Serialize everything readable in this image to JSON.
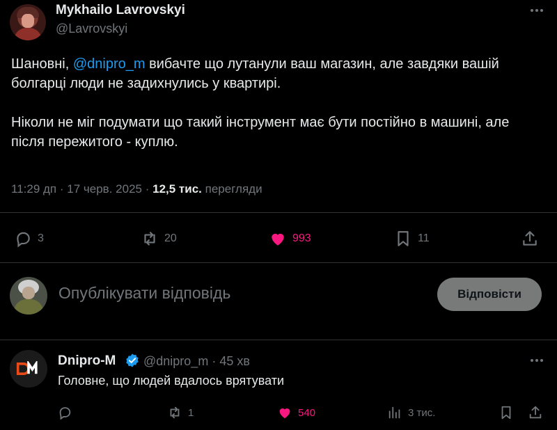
{
  "tweet": {
    "author_name": "Mykhailo Lavrovskyi",
    "author_handle": "@Lavrovskyi",
    "text_prefix": "Шановні, ",
    "mention": "@dnipro_m",
    "text_rest": " вибачте що лутанули ваш магазин, але завдяки вашій болгарці люди не задихнулись у квартирі.",
    "text_paragraph2": "Ніколи не міг подумати що такий інструмент має бути постійно в машині, але після пережитого - куплю.",
    "time": "11:29 дп",
    "separator": "·",
    "date": "17 черв. 2025",
    "views_count": "12,5 тис.",
    "views_label": "перегляди",
    "replies": "3",
    "reposts": "20",
    "likes": "993",
    "bookmarks": "11"
  },
  "composer": {
    "placeholder": "Опублікувати відповідь",
    "reply_button": "Відповісти"
  },
  "reply": {
    "author_name": "Dnipro-M",
    "author_handle": "@dnipro_m",
    "separator": "·",
    "time_ago": "45 хв",
    "text": "Головне, що людей вдалось врятувати",
    "replies": "",
    "reposts": "1",
    "likes": "540",
    "views": "3 тис."
  },
  "colors": {
    "background": "#000000",
    "text": "#e7e9ea",
    "muted": "#71767b",
    "accent": "#1d9bf0",
    "like": "#f91880",
    "divider": "#2f3336",
    "dnipro_brand": "#e84a1a"
  },
  "icons": [
    "more-icon",
    "reply-icon",
    "repost-icon",
    "like-icon",
    "bookmark-icon",
    "share-icon",
    "verified-icon",
    "views-icon"
  ]
}
